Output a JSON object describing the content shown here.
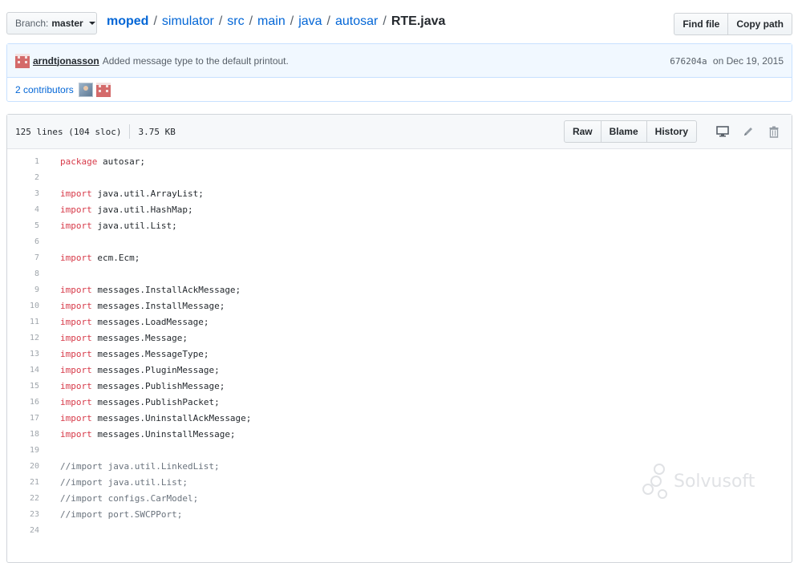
{
  "branch": {
    "label": "Branch:",
    "value": "master"
  },
  "breadcrumb": {
    "parts": [
      "moped",
      "simulator",
      "src",
      "main",
      "java",
      "autosar"
    ],
    "separator": "/",
    "file": "RTE.java"
  },
  "actions": {
    "find_file": "Find file",
    "copy_path": "Copy path"
  },
  "commit": {
    "author": "arndtjonasson",
    "message": "Added message type to the default printout.",
    "sha": "676204a",
    "date_text": "on Dec 19, 2015"
  },
  "contributors": {
    "label": "2 contributors"
  },
  "file": {
    "lines_info": "125 lines (104 sloc)",
    "size": "3.75 KB",
    "buttons": {
      "raw": "Raw",
      "blame": "Blame",
      "history": "History"
    }
  },
  "code_lines": [
    {
      "n": "1",
      "kw": "package",
      "rest": " autosar;",
      "comment": ""
    },
    {
      "n": "2",
      "kw": "",
      "rest": "",
      "comment": ""
    },
    {
      "n": "3",
      "kw": "import",
      "rest": " java.util.ArrayList;",
      "comment": ""
    },
    {
      "n": "4",
      "kw": "import",
      "rest": " java.util.HashMap;",
      "comment": ""
    },
    {
      "n": "5",
      "kw": "import",
      "rest": " java.util.List;",
      "comment": ""
    },
    {
      "n": "6",
      "kw": "",
      "rest": "",
      "comment": ""
    },
    {
      "n": "7",
      "kw": "import",
      "rest": " ecm.Ecm;",
      "comment": ""
    },
    {
      "n": "8",
      "kw": "",
      "rest": "",
      "comment": ""
    },
    {
      "n": "9",
      "kw": "import",
      "rest": " messages.InstallAckMessage;",
      "comment": ""
    },
    {
      "n": "10",
      "kw": "import",
      "rest": " messages.InstallMessage;",
      "comment": ""
    },
    {
      "n": "11",
      "kw": "import",
      "rest": " messages.LoadMessage;",
      "comment": ""
    },
    {
      "n": "12",
      "kw": "import",
      "rest": " messages.Message;",
      "comment": ""
    },
    {
      "n": "13",
      "kw": "import",
      "rest": " messages.MessageType;",
      "comment": ""
    },
    {
      "n": "14",
      "kw": "import",
      "rest": " messages.PluginMessage;",
      "comment": ""
    },
    {
      "n": "15",
      "kw": "import",
      "rest": " messages.PublishMessage;",
      "comment": ""
    },
    {
      "n": "16",
      "kw": "import",
      "rest": " messages.PublishPacket;",
      "comment": ""
    },
    {
      "n": "17",
      "kw": "import",
      "rest": " messages.UninstallAckMessage;",
      "comment": ""
    },
    {
      "n": "18",
      "kw": "import",
      "rest": " messages.UninstallMessage;",
      "comment": ""
    },
    {
      "n": "19",
      "kw": "",
      "rest": "",
      "comment": ""
    },
    {
      "n": "20",
      "kw": "",
      "rest": "",
      "comment": "//import java.util.LinkedList;"
    },
    {
      "n": "21",
      "kw": "",
      "rest": "",
      "comment": "//import java.util.List;"
    },
    {
      "n": "22",
      "kw": "",
      "rest": "",
      "comment": "//import configs.CarModel;"
    },
    {
      "n": "23",
      "kw": "",
      "rest": "",
      "comment": "//import port.SWCPPort;"
    },
    {
      "n": "24",
      "kw": "",
      "rest": "",
      "comment": ""
    }
  ],
  "watermark": {
    "text": "Solvusoft"
  },
  "colors": {
    "link": "#0366d6",
    "keyword": "#d73a49",
    "comment": "#6a737d",
    "commit_bg": "#f1f8ff"
  }
}
